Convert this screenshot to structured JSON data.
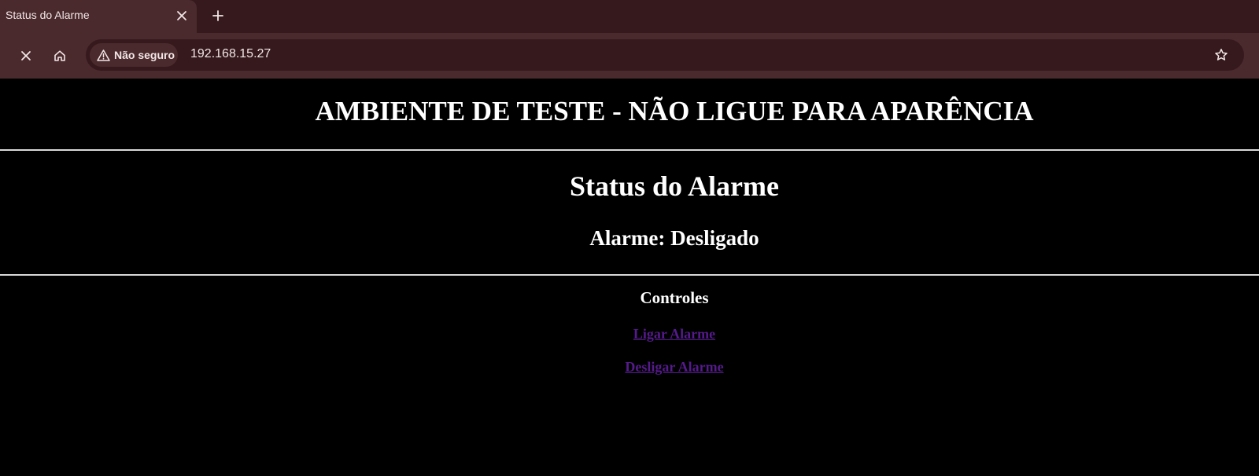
{
  "browser": {
    "tab_title": "Status do Alarme",
    "security_label": "Não seguro",
    "url": "192.168.15.27",
    "icons": {
      "tab_close": "close-icon",
      "new_tab": "plus-icon",
      "stop": "close-icon",
      "home": "home-icon",
      "warning": "warning-icon",
      "bookmark": "star-icon"
    },
    "colors": {
      "tabstrip": "#35191c",
      "toolbar": "#4a2a2d",
      "text": "#f2e6e6"
    }
  },
  "page": {
    "banner": "AMBIENTE DE TESTE - NÃO LIGUE PARA APARÊNCIA",
    "status_title": "Status do Alarme",
    "status_line": "Alarme: Desligado",
    "controls_heading": "Controles",
    "links": [
      {
        "label": "Ligar Alarme"
      },
      {
        "label": "Desligar Alarme"
      }
    ],
    "colors": {
      "background": "#000000",
      "text": "#ffffff",
      "link": "#551a8b"
    }
  }
}
